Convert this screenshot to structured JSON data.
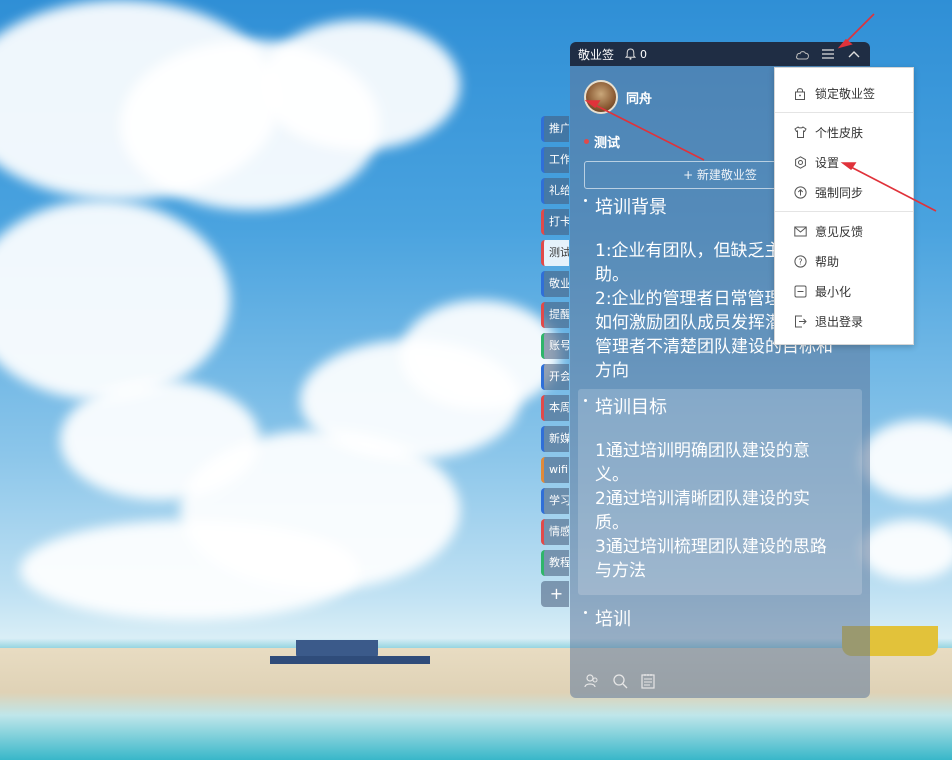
{
  "app": {
    "title": "敬业签",
    "notification_count": "0",
    "user_name": "同舟",
    "current_group": "测试",
    "new_note_label": "+ 新建敬业签"
  },
  "side_tabs": [
    {
      "label": "推广",
      "color": "#2f6fd8"
    },
    {
      "label": "工作",
      "color": "#2f6fd8"
    },
    {
      "label": "礼给",
      "color": "#2f6fd8"
    },
    {
      "label": "打卡",
      "color": "#e04a4a"
    },
    {
      "label": "测试",
      "color": "#e04a4a",
      "active": true
    },
    {
      "label": "敬业",
      "color": "#2f6fd8"
    },
    {
      "label": "提醒",
      "color": "#e04a4a"
    },
    {
      "label": "账号",
      "color": "#2fb56a"
    },
    {
      "label": "开会",
      "color": "#2f6fd8"
    },
    {
      "label": "本周",
      "color": "#e04a4a"
    },
    {
      "label": "新媒",
      "color": "#2f6fd8"
    },
    {
      "label": "wifi",
      "color": "#e08a3a"
    },
    {
      "label": "学习",
      "color": "#2f6fd8"
    },
    {
      "label": "情感",
      "color": "#e04a4a"
    },
    {
      "label": "教程",
      "color": "#2fb56a"
    },
    {
      "label": "+",
      "color": "transparent"
    }
  ],
  "notes": [
    {
      "title": "培训背景",
      "body": "1:企业有团队，但缺乏主\n助。\n2:企业的管理者日常管理\n如何激励团队成员发挥潜能。\n管理者不清楚团队建设的目标和\n方向"
    },
    {
      "title": "培训目标",
      "body": "1通过培训明确团队建设的意\n义。\n2通过培训清晰团队建设的实\n质。\n3通过培训梳理团队建设的思路\n与方法"
    },
    {
      "title": "培训",
      "body": ""
    }
  ],
  "menu": {
    "items": [
      {
        "label": "锁定敬业签",
        "icon": "lock-icon"
      },
      {
        "label": "个性皮肤",
        "icon": "shirt-icon"
      },
      {
        "label": "设置",
        "icon": "settings-icon"
      },
      {
        "label": "强制同步",
        "icon": "sync-icon"
      },
      {
        "label": "意见反馈",
        "icon": "mail-icon"
      },
      {
        "label": "帮助",
        "icon": "help-icon"
      },
      {
        "label": "最小化",
        "icon": "minimize-icon"
      },
      {
        "label": "退出登录",
        "icon": "logout-icon"
      }
    ]
  },
  "colors": {
    "titlebar": "#1f2d44",
    "annotation_arrow": "#e0323a"
  }
}
